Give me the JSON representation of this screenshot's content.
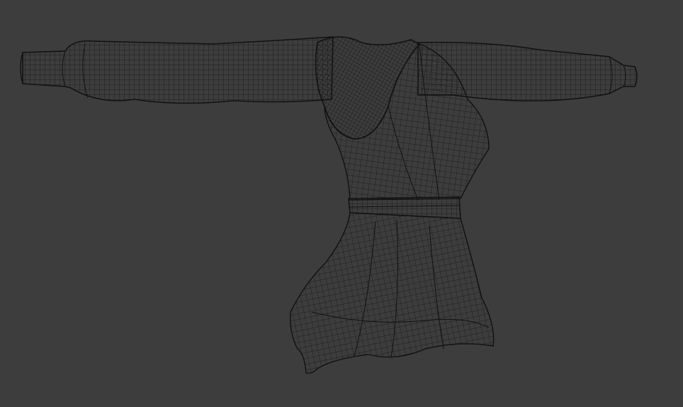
{
  "viewport": {
    "background": "#3d3d3d",
    "wire_color": "#141414"
  },
  "model": {
    "kind": "garment",
    "parts": [
      "left-sleeve",
      "right-sleeve",
      "hood",
      "bodice",
      "belt",
      "skirt"
    ]
  }
}
